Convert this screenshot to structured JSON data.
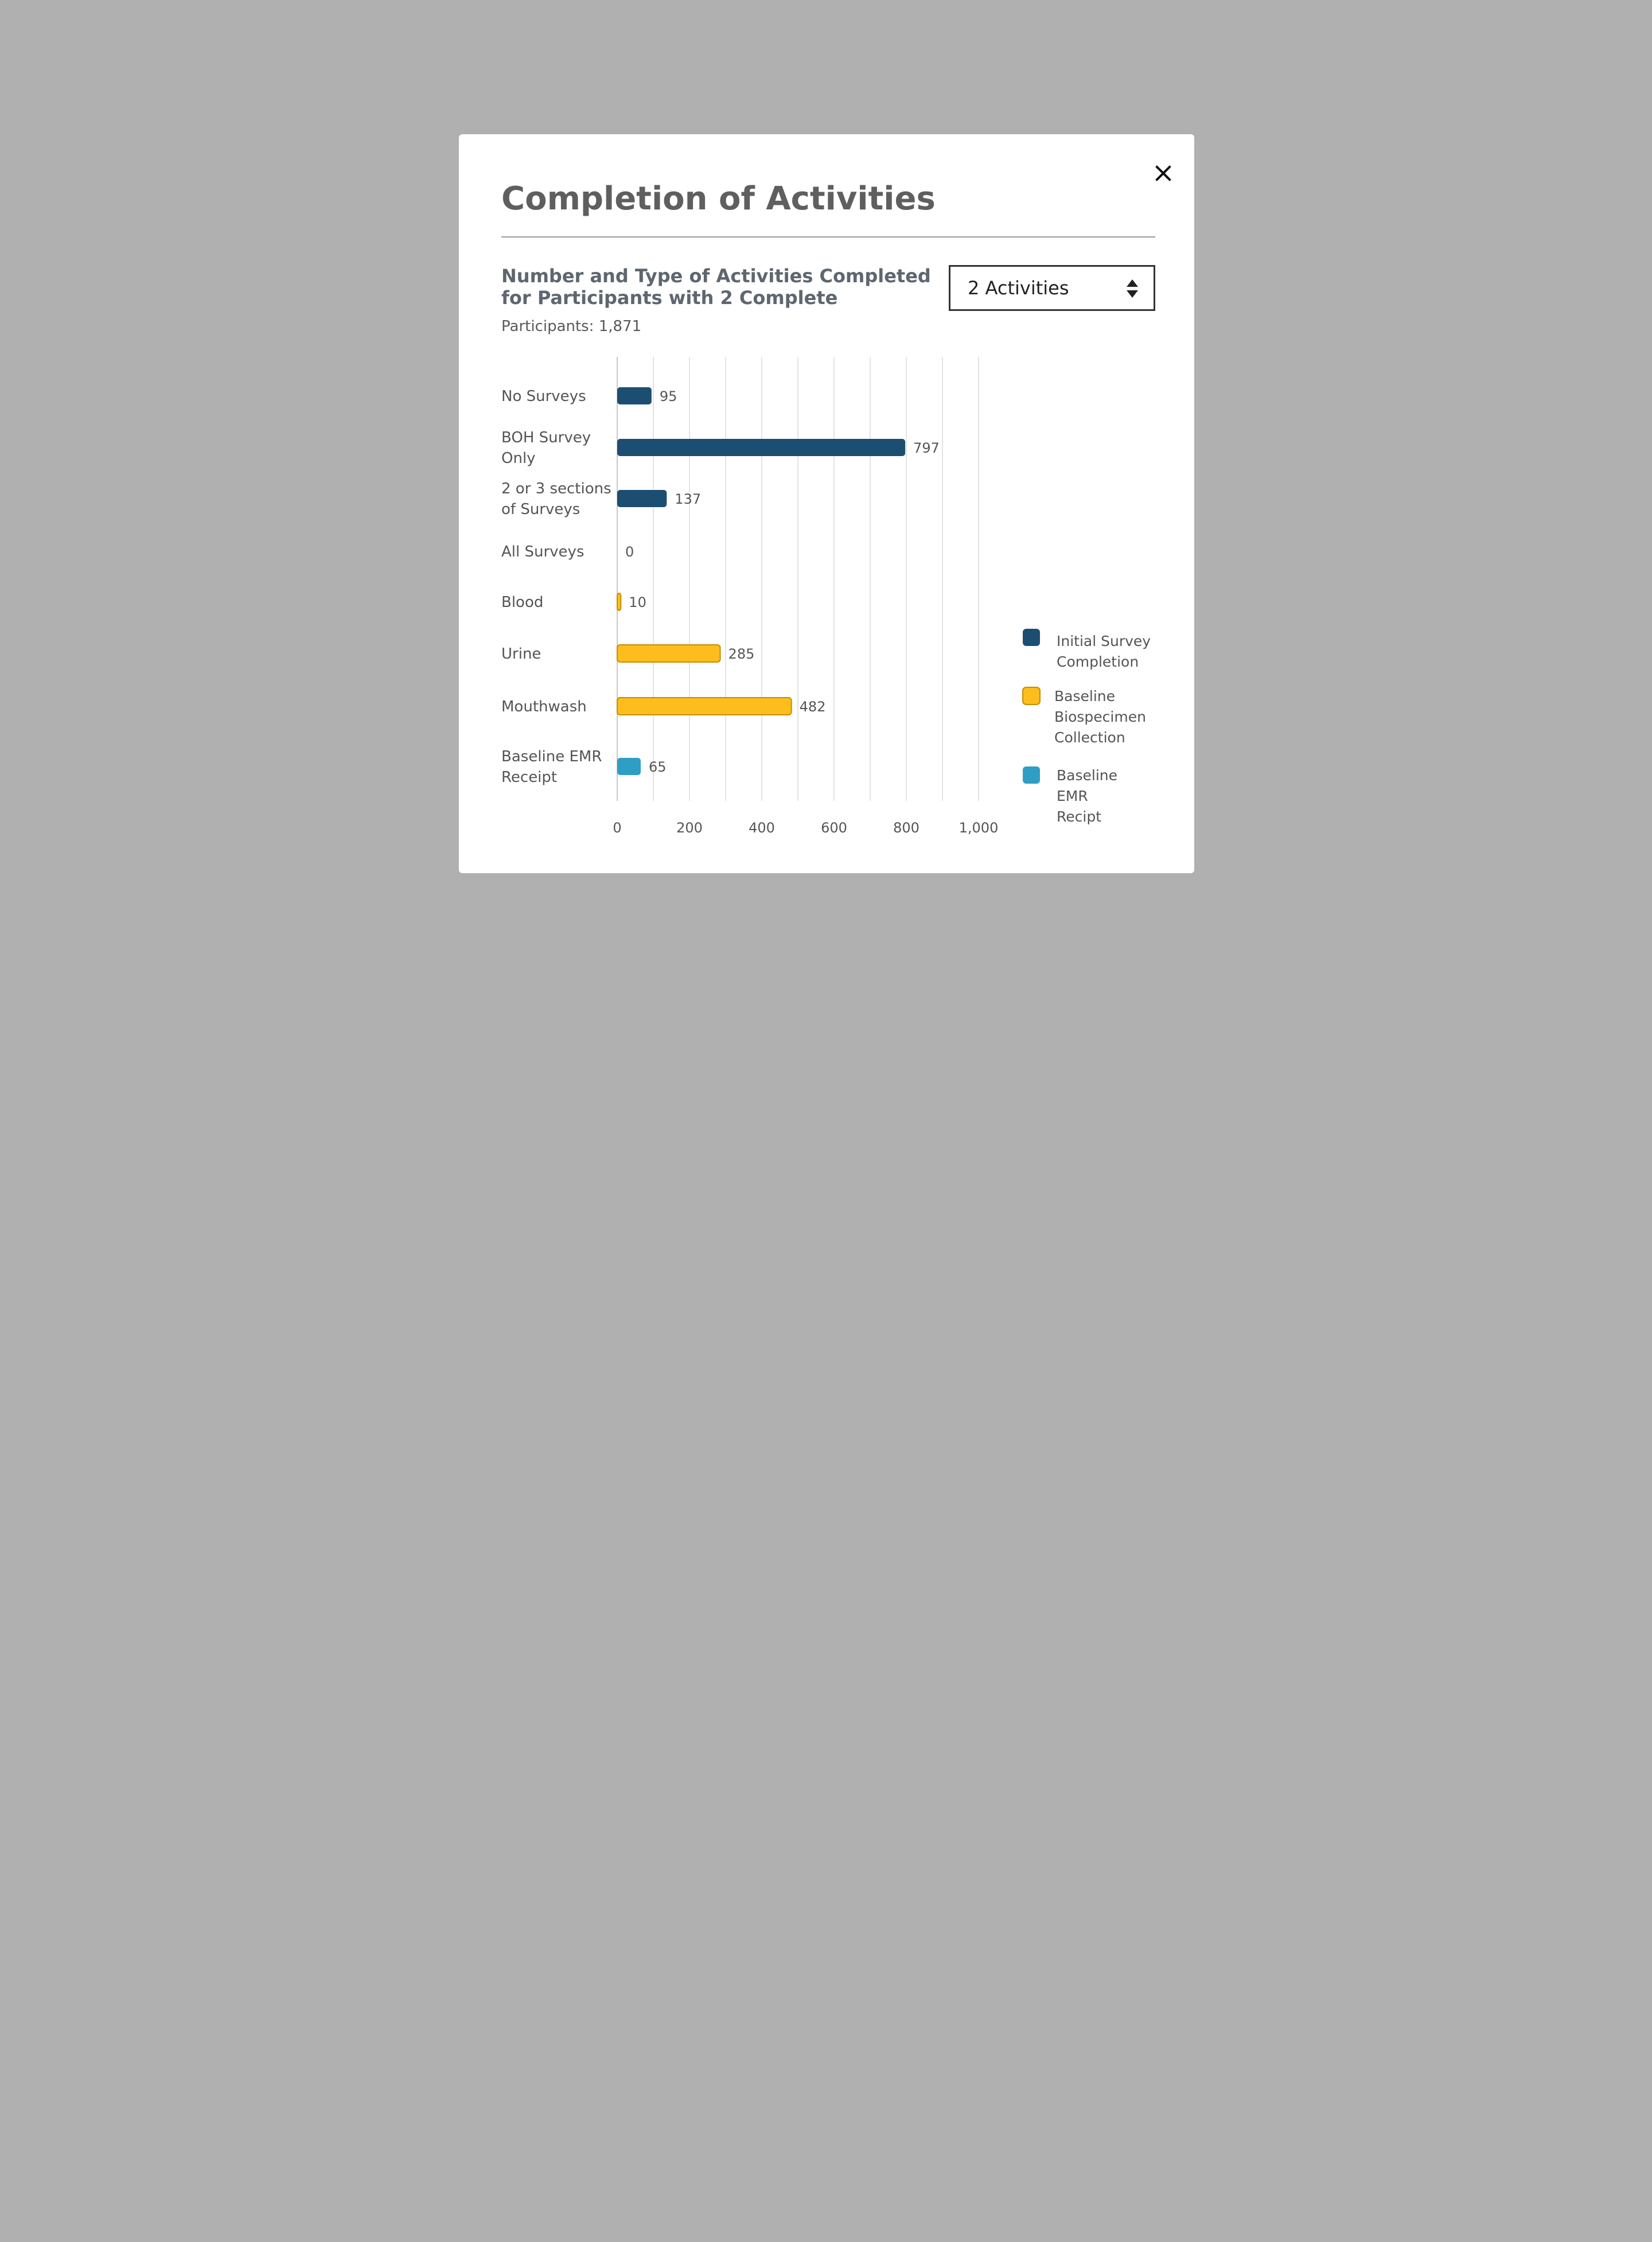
{
  "modal": {
    "title": "Completion of Activities",
    "subtitle": "Number and Type of Activities Completed for Participants with 2 Complete",
    "participants_label": "Participants: 1,871",
    "select": {
      "value": "2 Activities"
    },
    "close_icon": "close-icon",
    "select_icon": "sort-arrows-icon"
  },
  "colors": {
    "initial_survey": "#1c4e71",
    "biospecimen": "#fdbd1c",
    "biospecimen_border": "#c48e00",
    "emr": "#2e9ec4"
  },
  "chart_data": {
    "type": "bar",
    "orientation": "horizontal",
    "categories": [
      "No Surveys",
      "BOH Survey Only",
      "2 or 3 sections of Surveys",
      "All Surveys",
      "Blood",
      "Urine",
      "Mouthwash",
      "Baseline EMR Receipt"
    ],
    "category_lines": [
      [
        "No Surveys"
      ],
      [
        "BOH Survey",
        "Only"
      ],
      [
        "2 or 3 sections",
        "of Surveys"
      ],
      [
        "All Surveys"
      ],
      [
        "Blood"
      ],
      [
        "Urine"
      ],
      [
        "Mouthwash"
      ],
      [
        "Baseline EMR",
        "Receipt"
      ]
    ],
    "values": [
      95,
      797,
      137,
      0,
      10,
      285,
      482,
      65
    ],
    "value_labels": [
      "95",
      "797",
      "137",
      "0",
      "10",
      "285",
      "482",
      "65"
    ],
    "bar_series": [
      0,
      0,
      0,
      0,
      1,
      1,
      1,
      2
    ],
    "series": [
      {
        "name": "Initial Survey Completion",
        "legend_lines": [
          "Initial Survey",
          "Completion"
        ],
        "color": "#1c4e71"
      },
      {
        "name": "Baseline Biospecimen Collection",
        "legend_lines": [
          "Baseline",
          "Biospecimen",
          "Collection"
        ],
        "color": "#fdbd1c"
      },
      {
        "name": "Baseline EMR Recipt",
        "legend_lines": [
          "Baseline",
          "EMR",
          "Recipt"
        ],
        "color": "#2e9ec4"
      }
    ],
    "xlim": [
      0,
      1040
    ],
    "xticks": [
      0,
      200,
      400,
      600,
      800,
      1000
    ],
    "xtick_labels": [
      "0",
      "200",
      "400",
      "600",
      "800",
      "1,000"
    ],
    "grid_step": 100,
    "grid": true,
    "legend_position": "right"
  }
}
